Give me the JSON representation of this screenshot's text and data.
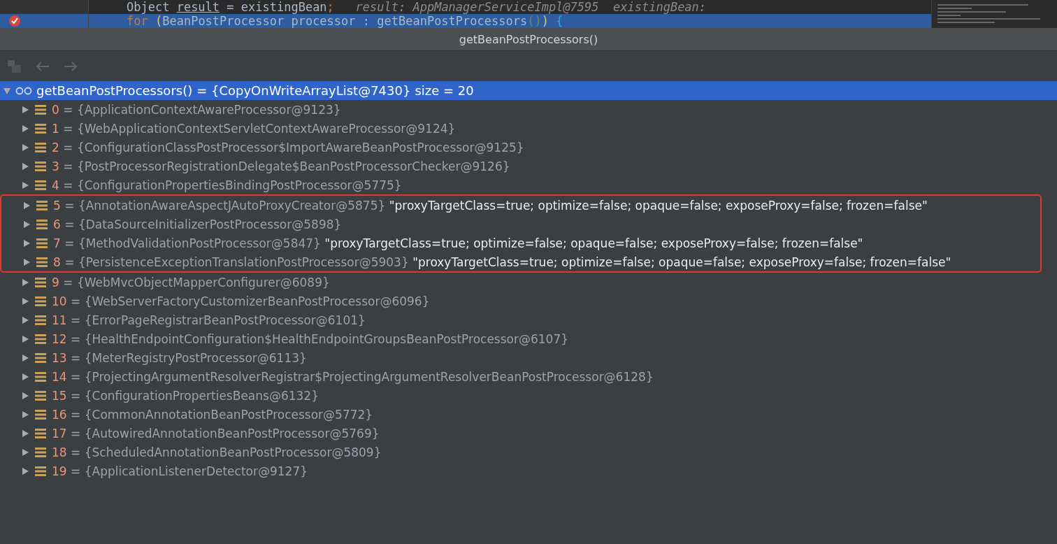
{
  "editor": {
    "lines": [
      {
        "selected": false,
        "breakpoint": false,
        "segments": [
          {
            "kind": "plain",
            "text": "Object "
          },
          {
            "kind": "underlined",
            "text": "result"
          },
          {
            "kind": "plain",
            "text": " = existingBean"
          },
          {
            "kind": "keyword",
            "text": ";"
          },
          {
            "kind": "comment",
            "text": "   result: AppManagerServiceImpl@7595  existingBean:"
          }
        ]
      },
      {
        "selected": true,
        "breakpoint": true,
        "segments": [
          {
            "kind": "keyword",
            "text": "for "
          },
          {
            "kind": "paren",
            "text": "("
          },
          {
            "kind": "plain",
            "text": "BeanPostProcessor processor : getBeanPostProcessors"
          },
          {
            "kind": "call",
            "text": "()"
          },
          {
            "kind": "paren",
            "text": ")"
          },
          {
            "kind": "brace",
            "text": " {"
          }
        ]
      }
    ]
  },
  "tooltip_title": "getBeanPostProcessors()",
  "toolbar": [
    {
      "kind": "frames",
      "disabled": true
    },
    {
      "kind": "back",
      "disabled": true
    },
    {
      "kind": "forward",
      "disabled": true
    }
  ],
  "variables": {
    "name": "getBeanPostProcessors()",
    "value": "= {CopyOnWriteArrayList@7430}",
    "size": "size = 20",
    "expanded": true,
    "selected": true,
    "children": [
      {
        "index": "0",
        "value": "= {ApplicationContextAwareProcessor@9123}",
        "framed": false
      },
      {
        "index": "1",
        "value": "= {WebApplicationContextServletContextAwareProcessor@9124}",
        "framed": false
      },
      {
        "index": "2",
        "value": "= {ConfigurationClassPostProcessor$ImportAwareBeanPostProcessor@9125}",
        "framed": false
      },
      {
        "index": "3",
        "value": "= {PostProcessorRegistrationDelegate$BeanPostProcessorChecker@9126}",
        "framed": false
      },
      {
        "index": "4",
        "value": "= {ConfigurationPropertiesBindingPostProcessor@5775}",
        "framed": false
      },
      {
        "index": "5",
        "value": "= {AnnotationAwareAspectJAutoProxyCreator@5875}",
        "string": "\"proxyTargetClass=true; optimize=false; opaque=false; exposeProxy=false; frozen=false\"",
        "framed": true
      },
      {
        "index": "6",
        "value": "= {DataSourceInitializerPostProcessor@5898}",
        "framed": true
      },
      {
        "index": "7",
        "value": "= {MethodValidationPostProcessor@5847}",
        "string": "\"proxyTargetClass=true; optimize=false; opaque=false; exposeProxy=false; frozen=false\"",
        "framed": true
      },
      {
        "index": "8",
        "value": "= {PersistenceExceptionTranslationPostProcessor@5903}",
        "string": "\"proxyTargetClass=true; optimize=false; opaque=false; exposeProxy=false; frozen=false\"",
        "framed": true
      },
      {
        "index": "9",
        "value": "= {WebMvcObjectMapperConfigurer@6089}",
        "framed": false
      },
      {
        "index": "10",
        "value": "= {WebServerFactoryCustomizerBeanPostProcessor@6096}",
        "framed": false
      },
      {
        "index": "11",
        "value": "= {ErrorPageRegistrarBeanPostProcessor@6101}",
        "framed": false
      },
      {
        "index": "12",
        "value": "= {HealthEndpointConfiguration$HealthEndpointGroupsBeanPostProcessor@6107}",
        "framed": false
      },
      {
        "index": "13",
        "value": "= {MeterRegistryPostProcessor@6113}",
        "framed": false
      },
      {
        "index": "14",
        "value": "= {ProjectingArgumentResolverRegistrar$ProjectingArgumentResolverBeanPostProcessor@6128}",
        "framed": false
      },
      {
        "index": "15",
        "value": "= {ConfigurationPropertiesBeans@6132}",
        "framed": false
      },
      {
        "index": "16",
        "value": "= {CommonAnnotationBeanPostProcessor@5772}",
        "framed": false
      },
      {
        "index": "17",
        "value": "= {AutowiredAnnotationBeanPostProcessor@5769}",
        "framed": false
      },
      {
        "index": "18",
        "value": "= {ScheduledAnnotationBeanPostProcessor@5809}",
        "framed": false
      },
      {
        "index": "19",
        "value": "= {ApplicationListenerDetector@9127}",
        "framed": false
      }
    ]
  }
}
